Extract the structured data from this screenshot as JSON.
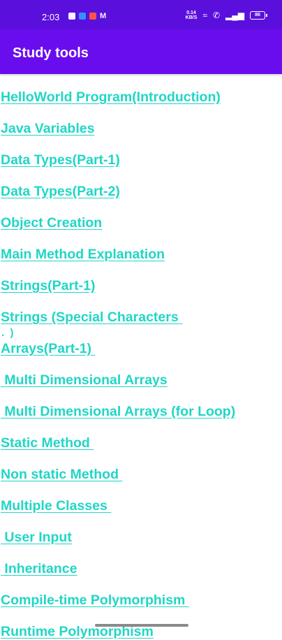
{
  "status_bar": {
    "time": "2:03",
    "notification_icons": [
      "message-icon",
      "app-icon",
      "shopping-icon",
      "m-icon"
    ],
    "network_speed_value": "0.14",
    "network_speed_unit": "KB/S",
    "battery_level": "86"
  },
  "app_bar": {
    "title": "Study tools",
    "background_color": "#6a0dee"
  },
  "list": {
    "link_color": "#21d6c6",
    "items": [
      "HelloWorld Program(Introduction)",
      "Java Variables",
      "Data Types(Part-1)",
      "Data Types(Part-2)",
      "Object Creation",
      "Main Method Explanation",
      "Strings(Part-1)",
      "Strings (Special Characters ",
      "Arrays(Part-1) ",
      " Multi Dimensional Arrays",
      " Multi Dimensional Arrays (for Loop)",
      "Static Method ",
      "Non static Method ",
      "Multiple Classes ",
      " User Input",
      " Inheritance",
      "Compile-time Polymorphism ",
      "Runtime Polymorphism"
    ],
    "stray_text": ".  )"
  }
}
